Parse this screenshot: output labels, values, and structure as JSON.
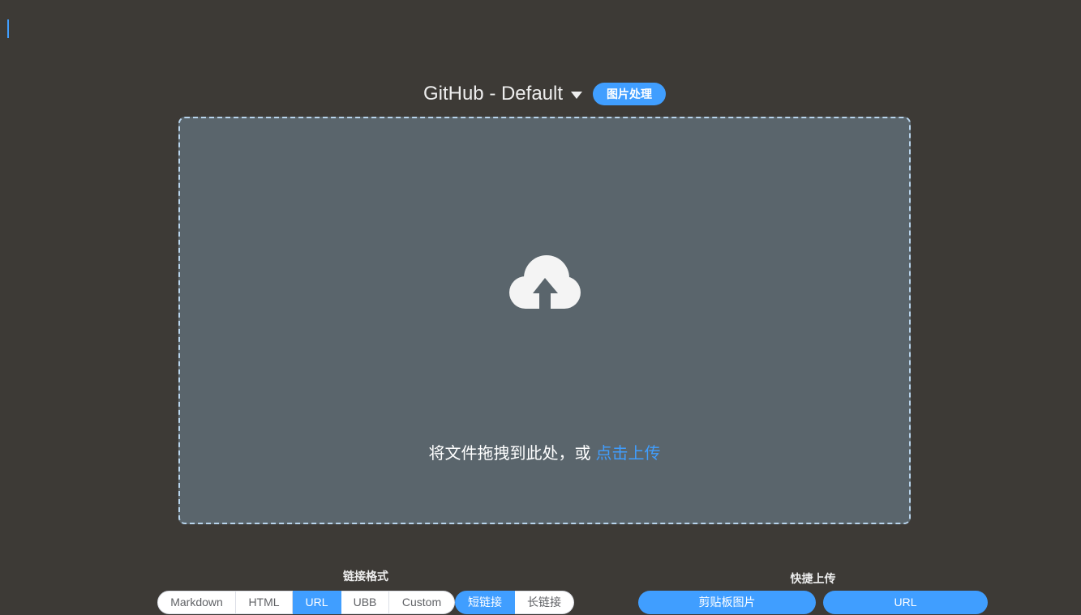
{
  "theme": {
    "background": "#3d3a36",
    "dropzone_fill": "#5a656c",
    "dropzone_border": "#b8d4ec",
    "accent": "#409eff"
  },
  "header": {
    "picbed_name": "GitHub - Default",
    "picbed_dropdown_icon": "caret-down-icon",
    "image_process_label": "图片处理"
  },
  "dropzone": {
    "icon": "cloud-upload-icon",
    "hint": "将文件拖拽到此处，或",
    "click_upload": "点击上传"
  },
  "link_format": {
    "label": "链接格式",
    "options": [
      "Markdown",
      "HTML",
      "URL",
      "UBB",
      "Custom"
    ],
    "selected": "URL"
  },
  "link_length": {
    "options": [
      "短链接",
      "长链接"
    ],
    "selected": "短链接"
  },
  "quick_upload": {
    "label": "快捷上传",
    "buttons": [
      "剪贴板图片",
      "URL"
    ]
  }
}
